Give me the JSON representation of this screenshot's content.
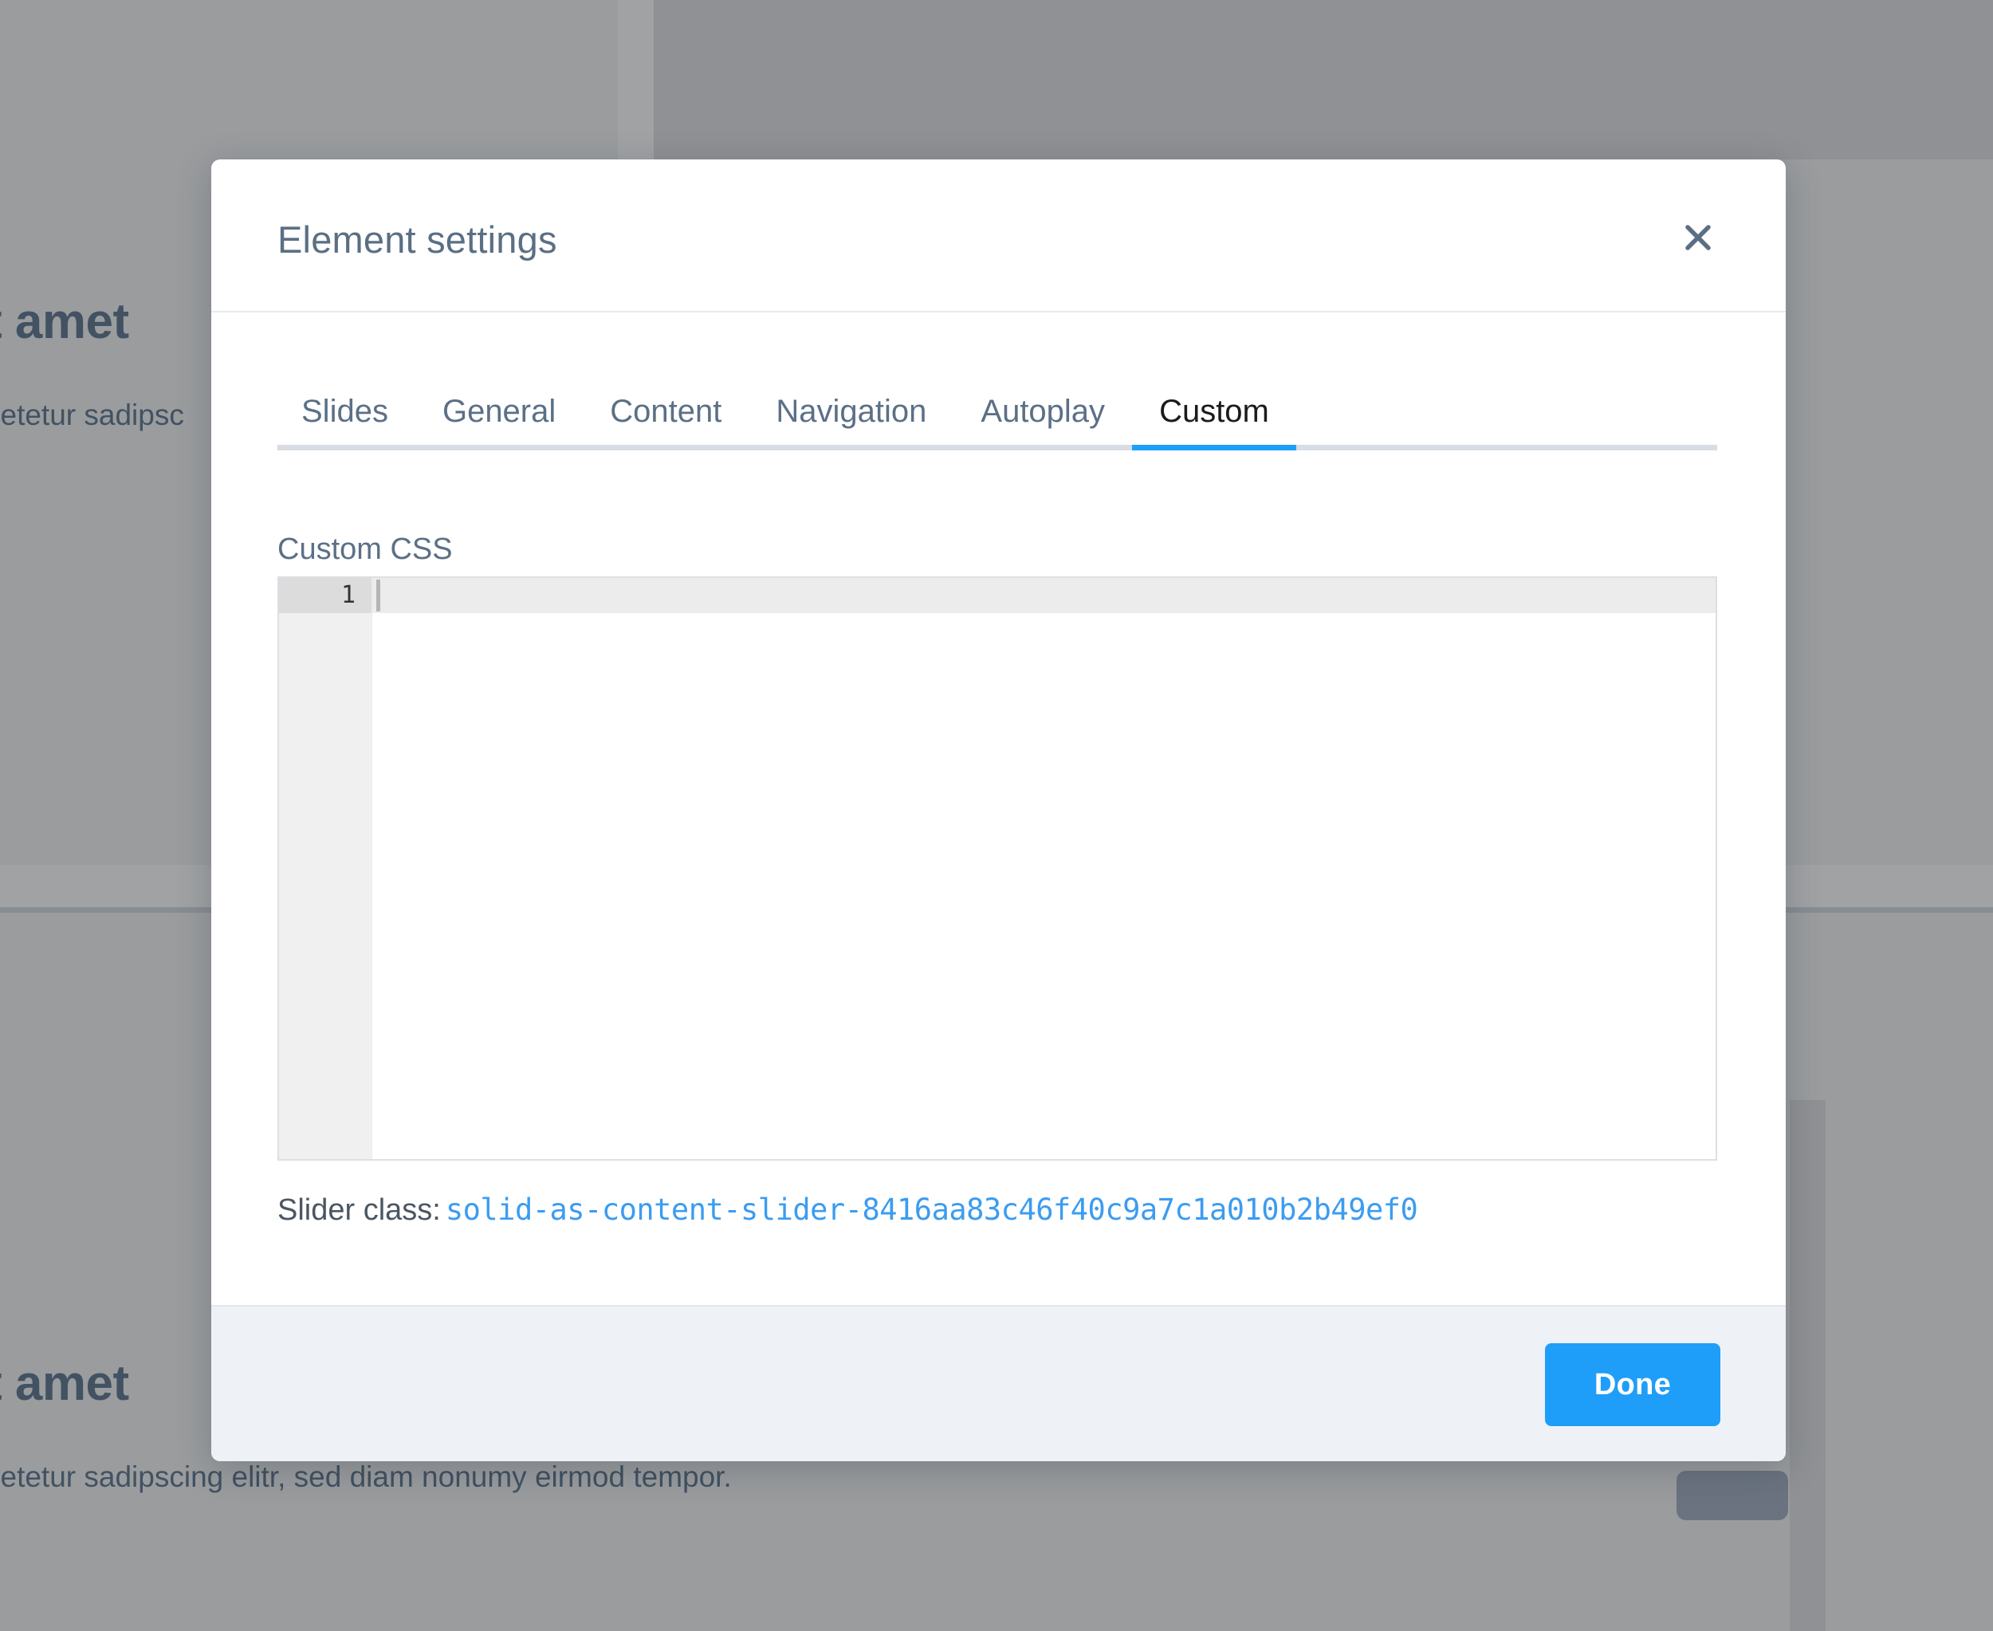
{
  "background": {
    "heading_top": "t amet",
    "body_top": "setetur sadipsc",
    "heading_bottom": "t amet",
    "body_bottom": "setetur sadipscing elitr, sed diam nonumy eirmod tempor.",
    "overlay_color": "#9a9c9e",
    "text_color": "#2f4356",
    "button_color": "#6b7380"
  },
  "modal": {
    "title": "Element settings",
    "close_icon": "close-icon",
    "tabs": [
      {
        "label": "Slides",
        "active": false
      },
      {
        "label": "General",
        "active": false
      },
      {
        "label": "Content",
        "active": false
      },
      {
        "label": "Navigation",
        "active": false
      },
      {
        "label": "Autoplay",
        "active": false
      },
      {
        "label": "Custom",
        "active": true
      }
    ],
    "active_tab": "Custom",
    "accent_color": "#1e9ef9",
    "custom": {
      "field_label": "Custom CSS",
      "editor": {
        "line_number": "1",
        "value": "",
        "placeholder": ""
      },
      "slider_class_label": "Slider class:",
      "slider_class_value": "solid-as-content-slider-8416aa83c46f40c9a7c1a010b2b49ef0"
    },
    "footer": {
      "done_label": "Done"
    }
  }
}
